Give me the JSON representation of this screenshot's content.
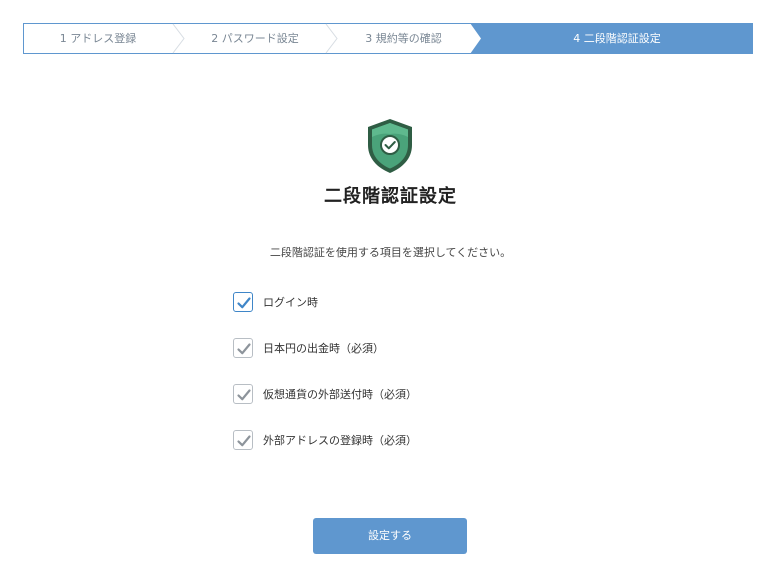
{
  "stepper": {
    "steps": [
      {
        "label": "1 アドレス登録"
      },
      {
        "label": "2 パスワード設定"
      },
      {
        "label": "3 規約等の確認"
      },
      {
        "label": "4 二段階認証設定"
      }
    ],
    "active_step": 4
  },
  "header": {
    "icon": "shield-check-icon",
    "title": "二段階認証設定"
  },
  "instruction": "二段階認証を使用する項目を選択してください。",
  "options": [
    {
      "label": "ログイン時",
      "checked": true,
      "required": false
    },
    {
      "label": "日本円の出金時（必須）",
      "checked": true,
      "required": true
    },
    {
      "label": "仮想通貨の外部送付時（必須）",
      "checked": true,
      "required": true
    },
    {
      "label": "外部アドレスの登録時（必須）",
      "checked": true,
      "required": true
    }
  ],
  "submit_label": "設定する",
  "colors": {
    "accent": "#5f97cf",
    "shield_fill": "#4aa37a",
    "shield_dark": "#2f5d44",
    "check_enabled": "#3f86c8",
    "check_disabled": "#8d949b"
  }
}
